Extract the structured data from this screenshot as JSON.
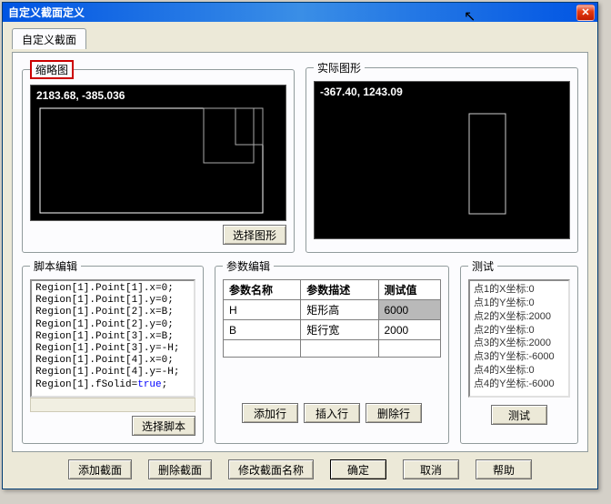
{
  "window": {
    "title": "自定义截面定义"
  },
  "tabs": {
    "main": "自定义截面"
  },
  "thumb": {
    "legend": "缩略图",
    "coord": "2183.68, -385.036",
    "select_btn": "选择图形"
  },
  "real": {
    "legend": "实际图形",
    "coord": "-367.40, 1243.09"
  },
  "script": {
    "legend": "脚本编辑",
    "lines": [
      "Region[1].Point[1].x=0;",
      "Region[1].Point[1].y=0;",
      "Region[1].Point[2].x=B;",
      "Region[1].Point[2].y=0;",
      "Region[1].Point[3].x=B;",
      "Region[1].Point[3].y=-H;",
      "Region[1].Point[4].x=0;",
      "Region[1].Point[4].y=-H;",
      "Region[1].fSolid="
    ],
    "true_token": "true",
    "semicolon": ";",
    "select_btn": "选择脚本"
  },
  "params": {
    "legend": "参数编辑",
    "headers": {
      "name": "参数名称",
      "desc": "参数描述",
      "test": "测试值"
    },
    "rows": [
      {
        "name": "H",
        "desc": "矩形高",
        "test": "6000"
      },
      {
        "name": "B",
        "desc": "矩行宽",
        "test": "2000"
      }
    ],
    "add_row": "添加行",
    "insert_row": "插入行",
    "delete_row": "删除行"
  },
  "test": {
    "legend": "测试",
    "items": [
      "点1的X坐标:0",
      "点1的Y坐标:0",
      "点2的X坐标:2000",
      "点2的Y坐标:0",
      "点3的X坐标:2000",
      "点3的Y坐标:-6000",
      "点4的X坐标:0",
      "点4的Y坐标:-6000"
    ],
    "btn": "测试"
  },
  "bottom": {
    "add_section": "添加截面",
    "delete_section": "删除截面",
    "rename_section": "修改截面名称",
    "ok": "确定",
    "cancel": "取消",
    "help": "帮助"
  }
}
